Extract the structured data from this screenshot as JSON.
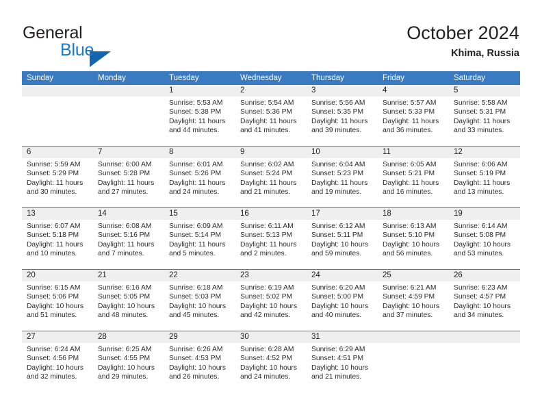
{
  "brand": {
    "line1": "General",
    "line2": "Blue",
    "logo_icon": "triangle-flag-icon"
  },
  "header": {
    "title": "October 2024",
    "location": "Khima, Russia"
  },
  "calendar": {
    "weekdays": [
      "Sunday",
      "Monday",
      "Tuesday",
      "Wednesday",
      "Thursday",
      "Friday",
      "Saturday"
    ],
    "colors": {
      "header_blue": "#3a7ac0",
      "date_band_gray": "#efefef",
      "brand_blue": "#1878c8",
      "logo_blue": "#1266ae",
      "text": "#222222"
    },
    "weeks": [
      [
        {
          "day": "",
          "empty": true,
          "lines": []
        },
        {
          "day": "",
          "empty": true,
          "lines": []
        },
        {
          "day": "1",
          "lines": [
            "Sunrise: 5:53 AM",
            "Sunset: 5:38 PM",
            "Daylight: 11 hours",
            "and 44 minutes."
          ]
        },
        {
          "day": "2",
          "lines": [
            "Sunrise: 5:54 AM",
            "Sunset: 5:36 PM",
            "Daylight: 11 hours",
            "and 41 minutes."
          ]
        },
        {
          "day": "3",
          "lines": [
            "Sunrise: 5:56 AM",
            "Sunset: 5:35 PM",
            "Daylight: 11 hours",
            "and 39 minutes."
          ]
        },
        {
          "day": "4",
          "lines": [
            "Sunrise: 5:57 AM",
            "Sunset: 5:33 PM",
            "Daylight: 11 hours",
            "and 36 minutes."
          ]
        },
        {
          "day": "5",
          "lines": [
            "Sunrise: 5:58 AM",
            "Sunset: 5:31 PM",
            "Daylight: 11 hours",
            "and 33 minutes."
          ]
        }
      ],
      [
        {
          "day": "6",
          "lines": [
            "Sunrise: 5:59 AM",
            "Sunset: 5:29 PM",
            "Daylight: 11 hours",
            "and 30 minutes."
          ]
        },
        {
          "day": "7",
          "lines": [
            "Sunrise: 6:00 AM",
            "Sunset: 5:28 PM",
            "Daylight: 11 hours",
            "and 27 minutes."
          ]
        },
        {
          "day": "8",
          "lines": [
            "Sunrise: 6:01 AM",
            "Sunset: 5:26 PM",
            "Daylight: 11 hours",
            "and 24 minutes."
          ]
        },
        {
          "day": "9",
          "lines": [
            "Sunrise: 6:02 AM",
            "Sunset: 5:24 PM",
            "Daylight: 11 hours",
            "and 21 minutes."
          ]
        },
        {
          "day": "10",
          "lines": [
            "Sunrise: 6:04 AM",
            "Sunset: 5:23 PM",
            "Daylight: 11 hours",
            "and 19 minutes."
          ]
        },
        {
          "day": "11",
          "lines": [
            "Sunrise: 6:05 AM",
            "Sunset: 5:21 PM",
            "Daylight: 11 hours",
            "and 16 minutes."
          ]
        },
        {
          "day": "12",
          "lines": [
            "Sunrise: 6:06 AM",
            "Sunset: 5:19 PM",
            "Daylight: 11 hours",
            "and 13 minutes."
          ]
        }
      ],
      [
        {
          "day": "13",
          "lines": [
            "Sunrise: 6:07 AM",
            "Sunset: 5:18 PM",
            "Daylight: 11 hours",
            "and 10 minutes."
          ]
        },
        {
          "day": "14",
          "lines": [
            "Sunrise: 6:08 AM",
            "Sunset: 5:16 PM",
            "Daylight: 11 hours",
            "and 7 minutes."
          ]
        },
        {
          "day": "15",
          "lines": [
            "Sunrise: 6:09 AM",
            "Sunset: 5:14 PM",
            "Daylight: 11 hours",
            "and 5 minutes."
          ]
        },
        {
          "day": "16",
          "lines": [
            "Sunrise: 6:11 AM",
            "Sunset: 5:13 PM",
            "Daylight: 11 hours",
            "and 2 minutes."
          ]
        },
        {
          "day": "17",
          "lines": [
            "Sunrise: 6:12 AM",
            "Sunset: 5:11 PM",
            "Daylight: 10 hours",
            "and 59 minutes."
          ]
        },
        {
          "day": "18",
          "lines": [
            "Sunrise: 6:13 AM",
            "Sunset: 5:10 PM",
            "Daylight: 10 hours",
            "and 56 minutes."
          ]
        },
        {
          "day": "19",
          "lines": [
            "Sunrise: 6:14 AM",
            "Sunset: 5:08 PM",
            "Daylight: 10 hours",
            "and 53 minutes."
          ]
        }
      ],
      [
        {
          "day": "20",
          "lines": [
            "Sunrise: 6:15 AM",
            "Sunset: 5:06 PM",
            "Daylight: 10 hours",
            "and 51 minutes."
          ]
        },
        {
          "day": "21",
          "lines": [
            "Sunrise: 6:16 AM",
            "Sunset: 5:05 PM",
            "Daylight: 10 hours",
            "and 48 minutes."
          ]
        },
        {
          "day": "22",
          "lines": [
            "Sunrise: 6:18 AM",
            "Sunset: 5:03 PM",
            "Daylight: 10 hours",
            "and 45 minutes."
          ]
        },
        {
          "day": "23",
          "lines": [
            "Sunrise: 6:19 AM",
            "Sunset: 5:02 PM",
            "Daylight: 10 hours",
            "and 42 minutes."
          ]
        },
        {
          "day": "24",
          "lines": [
            "Sunrise: 6:20 AM",
            "Sunset: 5:00 PM",
            "Daylight: 10 hours",
            "and 40 minutes."
          ]
        },
        {
          "day": "25",
          "lines": [
            "Sunrise: 6:21 AM",
            "Sunset: 4:59 PM",
            "Daylight: 10 hours",
            "and 37 minutes."
          ]
        },
        {
          "day": "26",
          "lines": [
            "Sunrise: 6:23 AM",
            "Sunset: 4:57 PM",
            "Daylight: 10 hours",
            "and 34 minutes."
          ]
        }
      ],
      [
        {
          "day": "27",
          "lines": [
            "Sunrise: 6:24 AM",
            "Sunset: 4:56 PM",
            "Daylight: 10 hours",
            "and 32 minutes."
          ]
        },
        {
          "day": "28",
          "lines": [
            "Sunrise: 6:25 AM",
            "Sunset: 4:55 PM",
            "Daylight: 10 hours",
            "and 29 minutes."
          ]
        },
        {
          "day": "29",
          "lines": [
            "Sunrise: 6:26 AM",
            "Sunset: 4:53 PM",
            "Daylight: 10 hours",
            "and 26 minutes."
          ]
        },
        {
          "day": "30",
          "lines": [
            "Sunrise: 6:28 AM",
            "Sunset: 4:52 PM",
            "Daylight: 10 hours",
            "and 24 minutes."
          ]
        },
        {
          "day": "31",
          "lines": [
            "Sunrise: 6:29 AM",
            "Sunset: 4:51 PM",
            "Daylight: 10 hours",
            "and 21 minutes."
          ]
        },
        {
          "day": "",
          "empty": true,
          "lines": []
        },
        {
          "day": "",
          "empty": true,
          "lines": []
        }
      ]
    ]
  }
}
